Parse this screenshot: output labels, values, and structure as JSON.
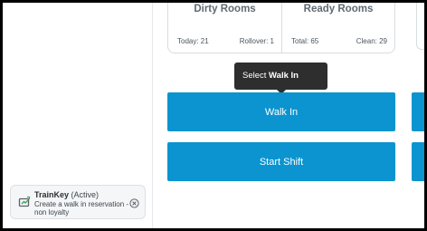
{
  "trainkey": {
    "name": "TrainKey",
    "status": "(Active)",
    "description": "Create a walk in reservation - non loyalty"
  },
  "cards": {
    "dirty": {
      "title": "Dirty Rooms",
      "left_stat": "Today: 21",
      "right_stat": "Rollover: 1"
    },
    "ready": {
      "title": "Ready Rooms",
      "left_stat": "Total: 65",
      "right_stat": "Clean: 29"
    }
  },
  "tooltip": {
    "prefix": "Select",
    "emphasis": "Walk In"
  },
  "buttons": {
    "walk_in": "Walk In",
    "start_shift": "Start Shift"
  },
  "colors": {
    "primary": "#0b94cf",
    "tooltip_bg": "#2e2e2e"
  },
  "icons": {
    "trainkey": "trainkey-logo-icon",
    "close": "close-circle-icon"
  }
}
